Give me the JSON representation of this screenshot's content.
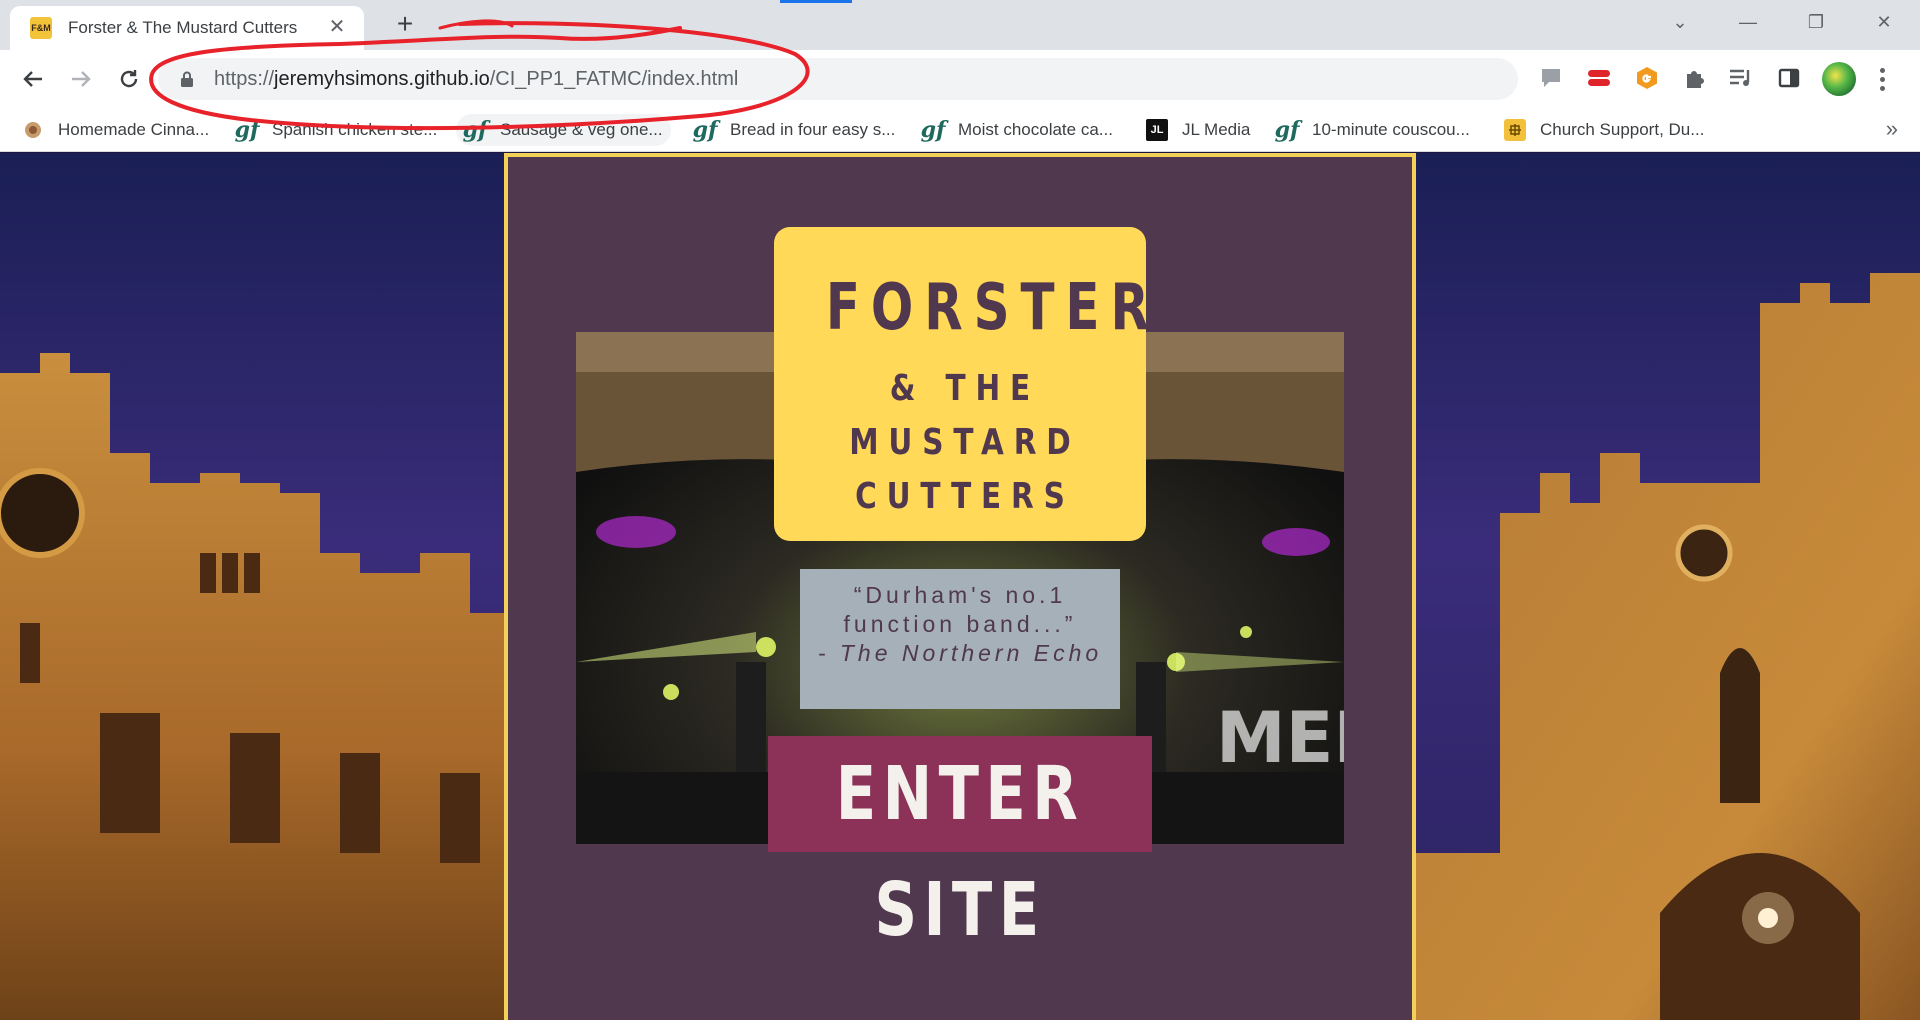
{
  "browser": {
    "tab": {
      "favicon_text": "F&M",
      "title": "Forster & The Mustard Cutters",
      "close_glyph": "✕"
    },
    "new_tab_glyph": "+",
    "window_controls": [
      "⌄",
      "—",
      "❐",
      "✕"
    ],
    "url": {
      "scheme": "https://",
      "host": "jeremyhsimons.github.io",
      "path": "/CI_PP1_FATMC/index.html"
    },
    "extension_icons": [
      "speech-bubble-icon",
      "lastpass-like-icon",
      "g-extension-icon",
      "puzzle-icon",
      "media-queue-icon",
      "side-panel-icon"
    ],
    "bookmarks": [
      {
        "icon": "recipe-photo-icon",
        "label": "Homemade Cinna..."
      },
      {
        "icon": "gf-icon",
        "label": "Spanish chicken ste..."
      },
      {
        "icon": "gf-icon",
        "label": "Sausage & veg one..."
      },
      {
        "icon": "gf-icon",
        "label": "Bread in four easy s..."
      },
      {
        "icon": "gf-icon",
        "label": "Moist chocolate ca..."
      },
      {
        "icon": "jl-icon",
        "label": "JL Media",
        "icon_text": "JL"
      },
      {
        "icon": "gf-icon",
        "label": "10-minute couscou..."
      },
      {
        "icon": "church-icon",
        "label": "Church Support, Du..."
      }
    ],
    "bookmark_icon_text": "gf",
    "bookmarks_overflow": "»",
    "annotation_color": "#e8222a"
  },
  "page": {
    "logo": {
      "line1": "FORSTER",
      "line2": "& THE\nMUSTARD\nCUTTERS"
    },
    "quote": {
      "text": "“Durham's no.1 function band...”",
      "attribution": "- The Northern Echo"
    },
    "enter_button": "ENTER SITE",
    "colors": {
      "panel": "#50384f",
      "border": "#f3d058",
      "logo_bg": "#ffd957",
      "quote_bg": "#a6b0b8",
      "button_bg": "#8c3158"
    }
  }
}
